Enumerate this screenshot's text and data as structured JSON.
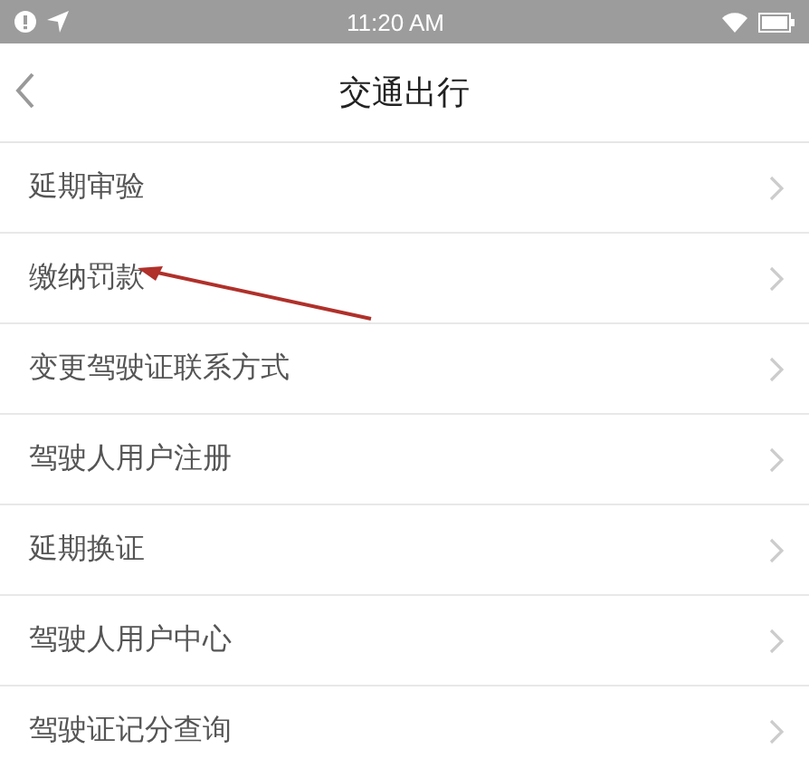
{
  "status_bar": {
    "time": "11:20 AM"
  },
  "nav_bar": {
    "title": "交通出行"
  },
  "menu_items": [
    {
      "label": "延期审验",
      "arrow_pointed": false
    },
    {
      "label": "缴纳罚款",
      "arrow_pointed": true
    },
    {
      "label": "变更驾驶证联系方式",
      "arrow_pointed": false
    },
    {
      "label": "驾驶人用户注册",
      "arrow_pointed": false
    },
    {
      "label": "延期换证",
      "arrow_pointed": false
    },
    {
      "label": "驾驶人用户中心",
      "arrow_pointed": false
    },
    {
      "label": "驾驶证记分查询",
      "arrow_pointed": false
    }
  ]
}
